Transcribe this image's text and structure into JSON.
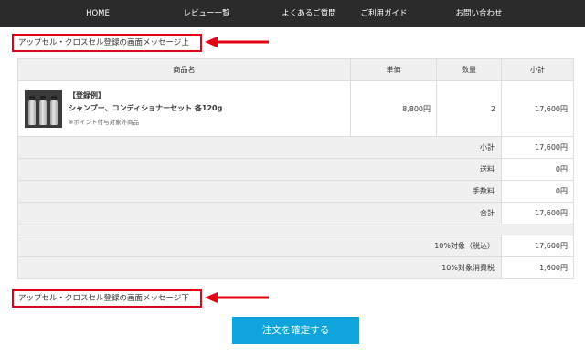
{
  "nav": {
    "items": [
      {
        "label": "HOME"
      },
      {
        "label": "レビュー一覧"
      },
      {
        "label": "よくあるご質問"
      },
      {
        "label": "ご利用ガイド"
      },
      {
        "label": "お問い合わせ"
      }
    ]
  },
  "upsell": {
    "top_text": "アップセル・クロスセル登録の画面メッセージ上",
    "bottom_text": "アップセル・クロスセル登録の画面メッセージ下",
    "annotation_color": "#e50012"
  },
  "cart": {
    "headers": {
      "product": "商品名",
      "unit_price": "単価",
      "quantity": "数量",
      "subtotal": "小計"
    },
    "items": [
      {
        "badge": "【登録例】",
        "name": "シャンプー、コンディショナーセット 各120g",
        "note": "※ポイント付与対象外商品",
        "unit_price": "8,800円",
        "quantity": "2",
        "subtotal": "17,600円",
        "image_icon": "product-bottles-image"
      }
    ],
    "summary": [
      {
        "label": "小計",
        "value": "17,600円"
      },
      {
        "label": "送料",
        "value": "0円"
      },
      {
        "label": "手数料",
        "value": "0円"
      },
      {
        "label": "合計",
        "value": "17,600円"
      }
    ],
    "tax": [
      {
        "label": "10%対象（税込）",
        "value": "17,600円"
      },
      {
        "label": "10%対象消費税",
        "value": "1,600円"
      }
    ]
  },
  "confirm_button": {
    "label": "注文を確定する",
    "color": "#10a4dc"
  }
}
